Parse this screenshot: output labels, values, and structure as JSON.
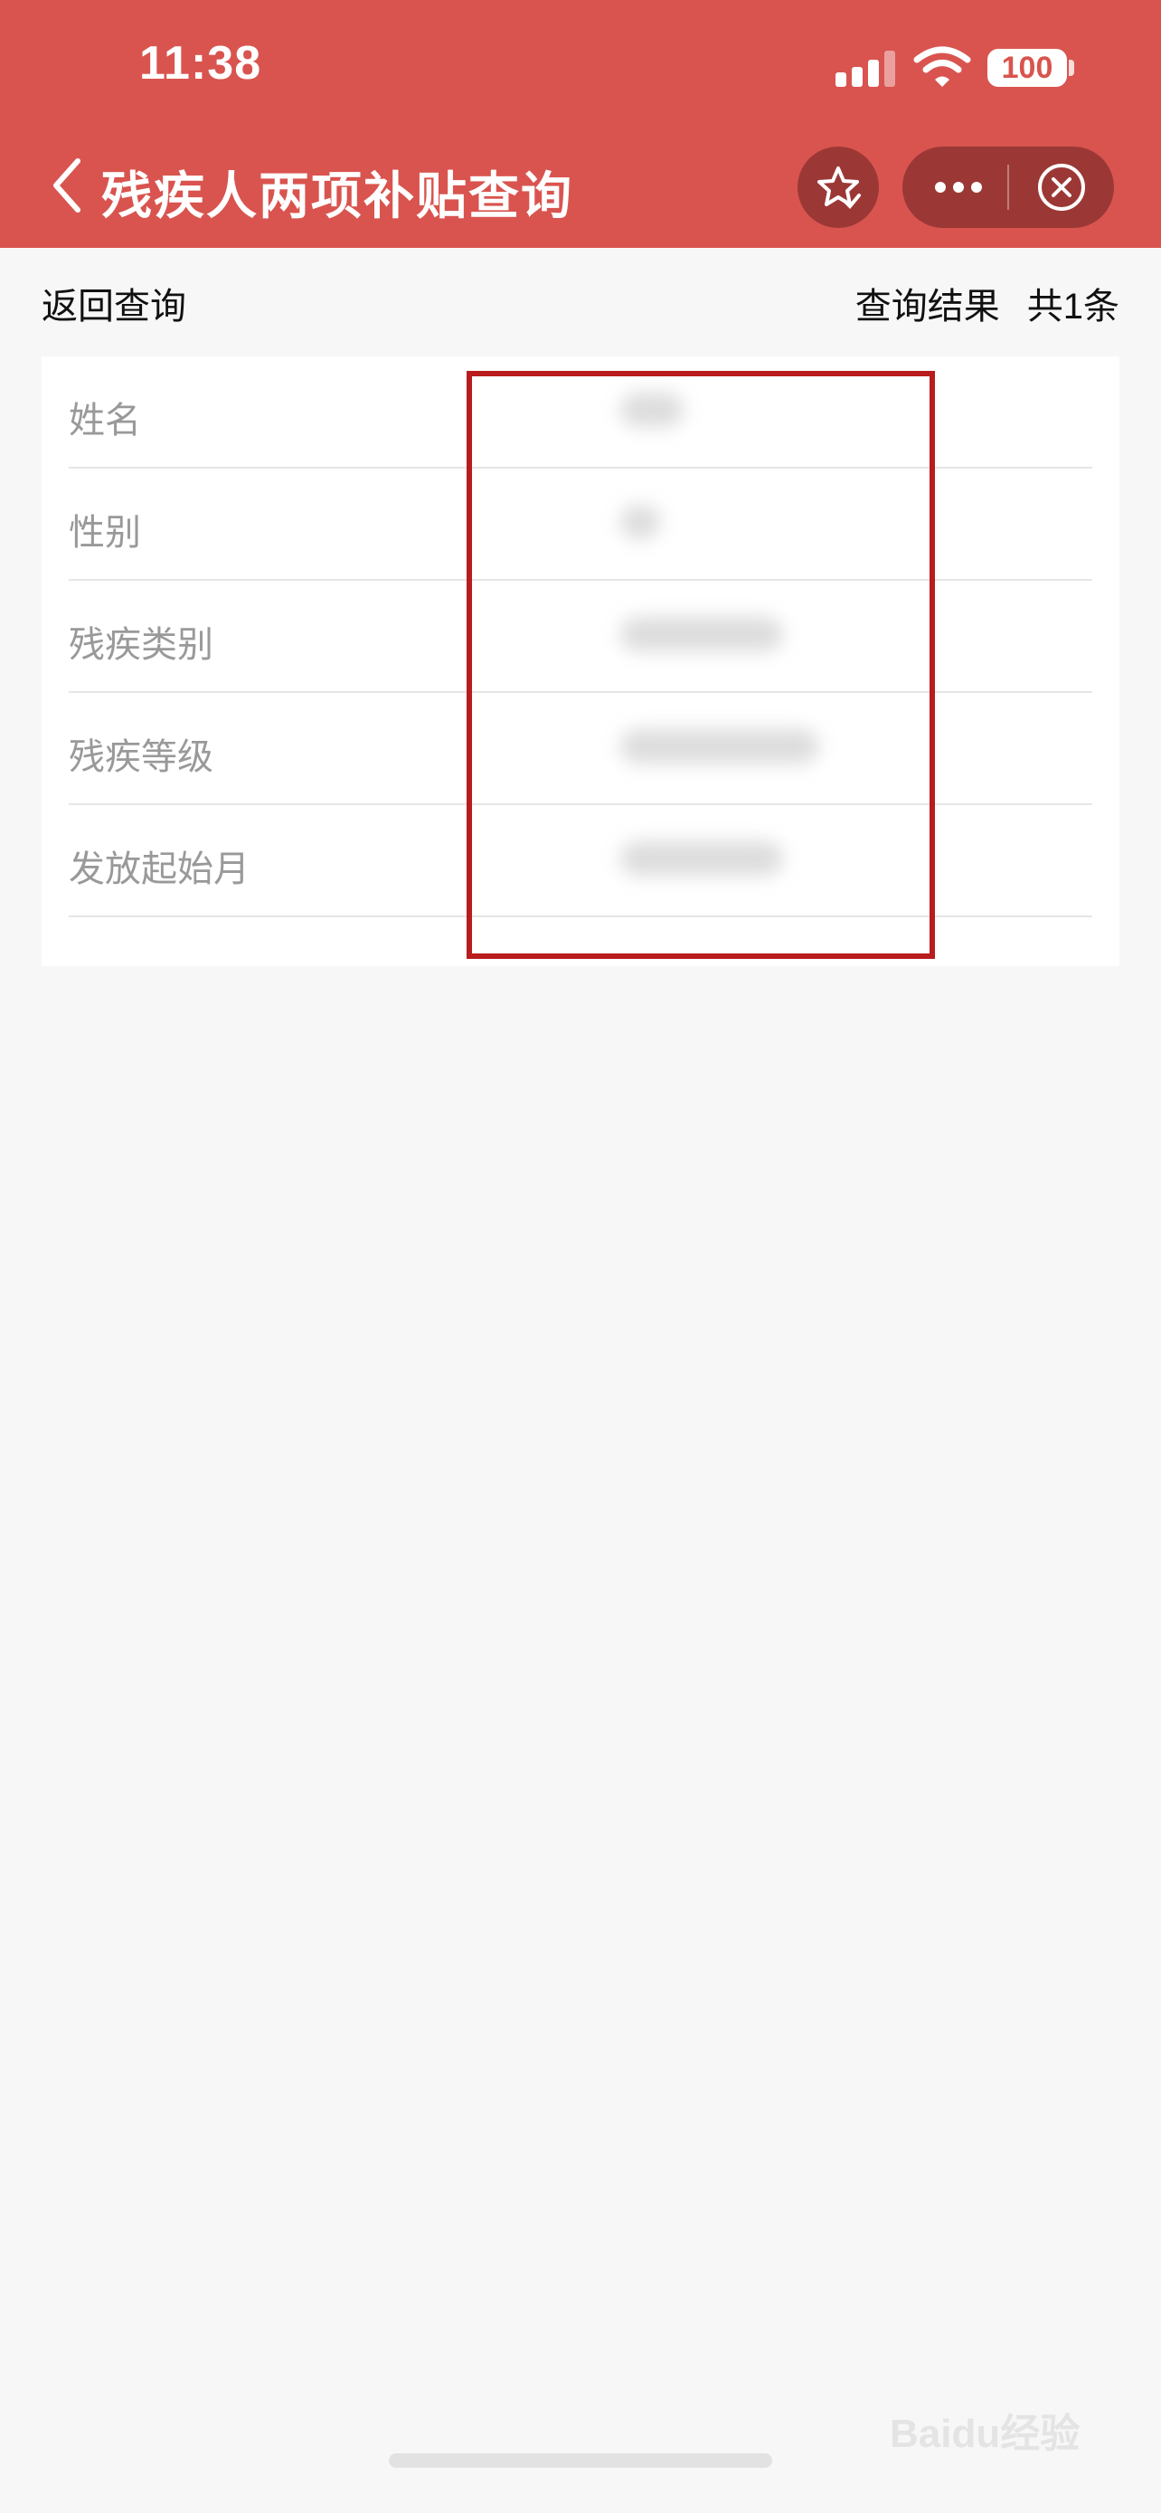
{
  "status_bar": {
    "time": "11:38",
    "battery": "100",
    "icons": [
      "signal-icon",
      "wifi-icon",
      "battery-icon"
    ]
  },
  "nav": {
    "title": "残疾人两项补贴查询",
    "icons": [
      "back-arrow-icon",
      "star-icon",
      "more-dots-icon",
      "close-circle-icon"
    ]
  },
  "subbar": {
    "back_label": "返回查询",
    "result_label": "查询结果",
    "count_label": "共1条"
  },
  "fields": [
    {
      "label": "姓名"
    },
    {
      "label": "性别"
    },
    {
      "label": "残疾类别"
    },
    {
      "label": "残疾等级"
    },
    {
      "label": "发放起始月"
    }
  ],
  "watermark": "Baidu经验",
  "colors": {
    "header": "#d9544f",
    "capsule": "#9b3835",
    "highlight": "#b81c1c",
    "background": "#f7f7f7"
  }
}
